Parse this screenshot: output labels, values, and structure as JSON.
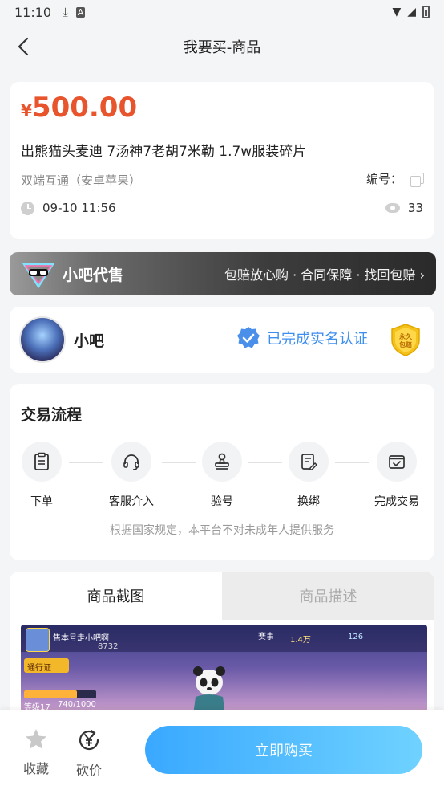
{
  "status_bar": {
    "time": "11:10",
    "icons": [
      "download-icon",
      "a-icon",
      "wifi-icon",
      "signal-icon",
      "battery-icon"
    ]
  },
  "nav": {
    "title": "我要买-商品"
  },
  "product": {
    "currency": "¥",
    "price": "500.00",
    "title": "出熊猫头麦迪 7汤神7老胡7米勒  1.7w服装碎片",
    "platform": "双端互通（安卓苹果）",
    "code_label": "编号：",
    "time": "09-10 11:56",
    "views": "33"
  },
  "banner": {
    "brand": "小吧代售",
    "slogan": "包赔放心购 · 合同保障 · 找回包赔 ›"
  },
  "seller": {
    "name": "小吧",
    "verified_text": "已完成实名认证",
    "badge_text": "永久包赔"
  },
  "flow": {
    "title": "交易流程",
    "steps": [
      {
        "label": "下单",
        "icon": "order-icon"
      },
      {
        "label": "客服介入",
        "icon": "headset-icon"
      },
      {
        "label": "验号",
        "icon": "stamp-icon"
      },
      {
        "label": "换绑",
        "icon": "document-edit-icon"
      },
      {
        "label": "完成交易",
        "icon": "check-box-icon"
      }
    ],
    "notice": "根据国家规定，本平台不对未成年人提供服务"
  },
  "tabs": {
    "screenshots": "商品截图",
    "description": "商品描述",
    "active": "screenshots"
  },
  "screenshot_overlay": {
    "seller_tag": "售本号走小吧啊",
    "coins": "8732",
    "pass": "通行证",
    "level": "等级17",
    "progress": "740/1000",
    "gold": "1.4万",
    "diamond": "126",
    "match": "赛事"
  },
  "bottom": {
    "favorite": "收藏",
    "bargain": "砍价",
    "buy": "立即购买"
  },
  "colors": {
    "price": "#e8542c",
    "verified": "#3c8ef0",
    "buy_gradient_start": "#39a8ff",
    "buy_gradient_end": "#6fd2ff"
  }
}
